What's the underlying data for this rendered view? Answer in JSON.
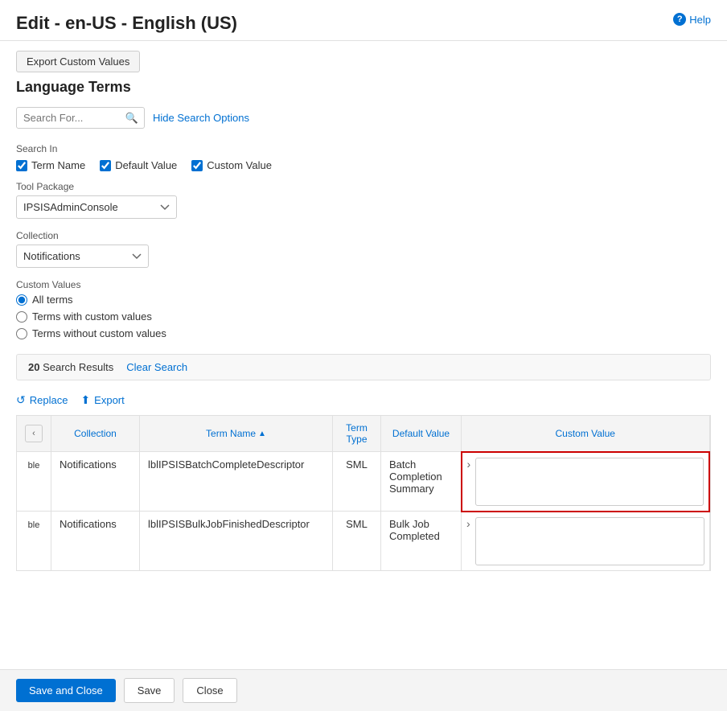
{
  "header": {
    "title": "Edit - en-US - English (US)",
    "help_label": "Help"
  },
  "toolbar": {
    "export_custom_values_label": "Export Custom Values"
  },
  "section": {
    "title": "Language Terms"
  },
  "search": {
    "placeholder": "Search For...",
    "hide_options_label": "Hide Search Options",
    "search_in_label": "Search In",
    "checkboxes": [
      {
        "label": "Term Name",
        "checked": true
      },
      {
        "label": "Default Value",
        "checked": true
      },
      {
        "label": "Custom Value",
        "checked": true
      }
    ],
    "tool_package": {
      "label": "Tool Package",
      "selected": "IPSISAdminConsole",
      "options": [
        "IPSISAdminConsole"
      ]
    },
    "collection": {
      "label": "Collection",
      "selected": "Notifications",
      "options": [
        "Notifications"
      ]
    },
    "custom_values": {
      "label": "Custom Values",
      "options": [
        {
          "label": "All terms",
          "selected": true
        },
        {
          "label": "Terms with custom values",
          "selected": false
        },
        {
          "label": "Terms without custom values",
          "selected": false
        }
      ]
    }
  },
  "results": {
    "count": "20",
    "results_label": "Search Results",
    "clear_label": "Clear Search"
  },
  "actions": {
    "replace_label": "Replace",
    "export_label": "Export"
  },
  "table": {
    "columns": [
      {
        "key": "nav",
        "label": ""
      },
      {
        "key": "collection",
        "label": "Collection"
      },
      {
        "key": "term_name",
        "label": "Term Name",
        "sortable": true,
        "sort_dir": "asc"
      },
      {
        "key": "term_type",
        "label": "Term Type"
      },
      {
        "key": "default_value",
        "label": "Default Value"
      },
      {
        "key": "custom_value",
        "label": "Custom Value",
        "highlighted": true
      }
    ],
    "rows": [
      {
        "nav": "ble",
        "collection": "Notifications",
        "term_name": "lblIPSISBatchCompleteDescriptor",
        "term_type": "SML",
        "default_value": "Batch Completion Summary",
        "custom_value": "",
        "custom_value_highlighted": true
      },
      {
        "nav": "ble",
        "collection": "Notifications",
        "term_name": "lblIPSISBulkJobFinishedDescriptor",
        "term_type": "SML",
        "default_value": "Bulk Job Completed",
        "custom_value": "",
        "custom_value_highlighted": false
      }
    ]
  },
  "footer": {
    "save_close_label": "Save and Close",
    "save_label": "Save",
    "close_label": "Close"
  }
}
